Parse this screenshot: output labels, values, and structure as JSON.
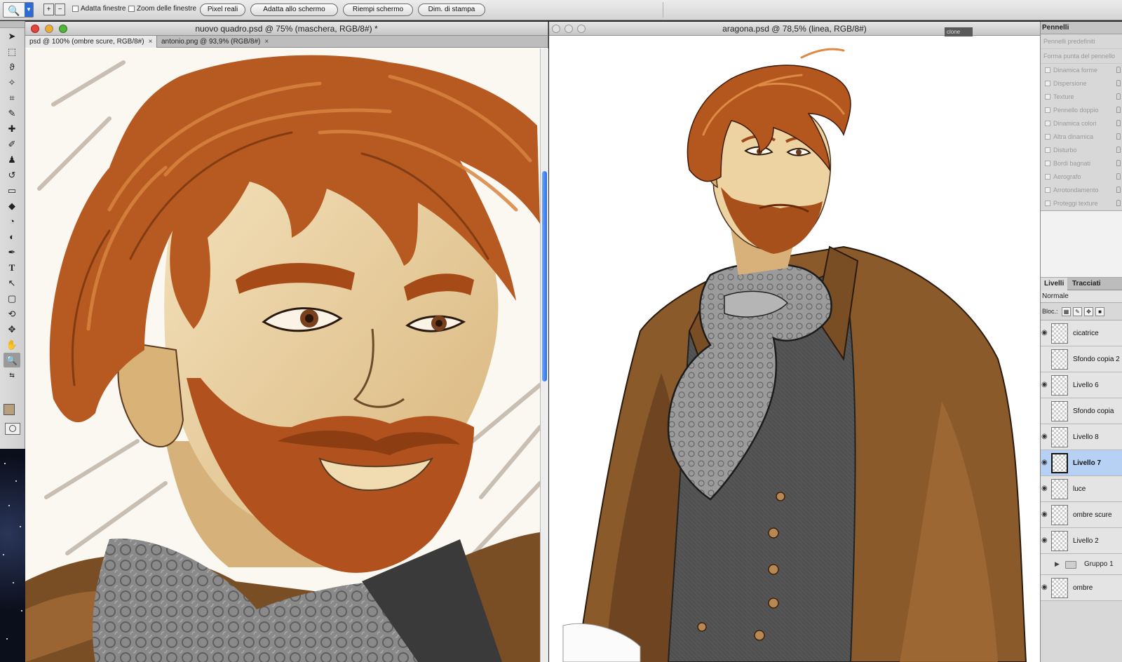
{
  "optionsbar": {
    "checkbox_resize_windows": "Adatta finestre",
    "checkbox_zoom_all": "Zoom delle finestre",
    "btn_actual_pixels": "Pixel reali",
    "btn_fit_screen": "Adatta allo schermo",
    "btn_fill_screen": "Riempi schermo",
    "btn_print_size": "Dim. di stampa"
  },
  "doc_left": {
    "title": "nuovo quadro.psd @ 75% (maschera, RGB/8#) *",
    "tabs": [
      {
        "label": "psd @ 100% (ombre scure, RGB/8#)",
        "close": "×"
      },
      {
        "label": "antonio.png @ 93,9% (RGB/8#)",
        "close": "×"
      }
    ]
  },
  "doc_right": {
    "title": "aragona.psd @ 78,5% (linea, RGB/8#)",
    "clone_tab": "clone"
  },
  "brushes_panel": {
    "tab": "Pennelli",
    "presets": "Pennelli predefiniti",
    "tip_shape": "Forma punta del pennello",
    "options": [
      "Dinamica forme",
      "Dispersione",
      "Texture",
      "Pennello doppio",
      "Dinamica colori",
      "Altra dinamica",
      "Disturbo",
      "Bordi bagnati",
      "Aerografo",
      "Arrotondamento",
      "Proteggi texture"
    ]
  },
  "layers_panel": {
    "tab_layers": "Livelli",
    "tab_paths": "Tracciati",
    "blend_mode": "Normale",
    "lock_label": "Bloc.:",
    "layers": [
      "cicatrice",
      "Sfondo copia 2",
      "Livello 6",
      "Sfondo copia",
      "Livello 8",
      "Livello 7",
      "luce",
      "ombre scure",
      "Livello 2"
    ],
    "selected": "Livello 7",
    "group": "Gruppo 1",
    "last_layer": "ombre"
  },
  "colors": {
    "foreground": "#b79f7d",
    "background": "#ffffff",
    "hair": "#b5561f",
    "coat": "#8a5a2b",
    "skin": "#efd6a6"
  }
}
